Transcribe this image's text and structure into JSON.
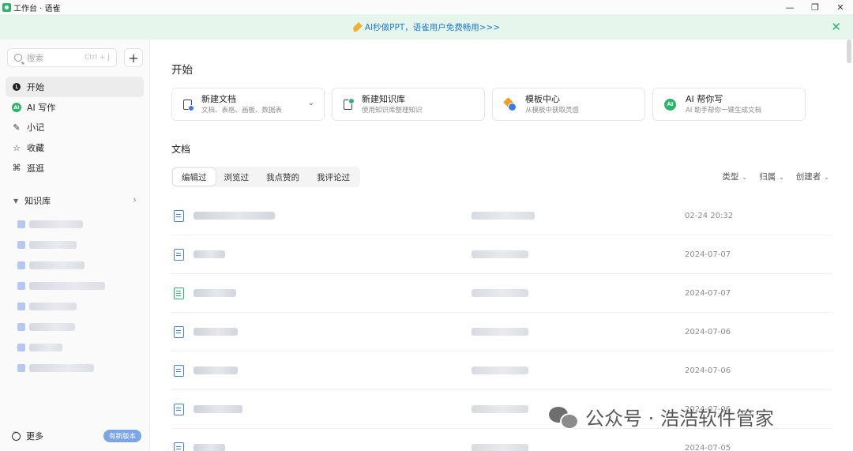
{
  "window": {
    "title": "工作台 · 语雀",
    "controls": [
      "—",
      "❐",
      "✕"
    ]
  },
  "banner": {
    "text": "AI秒做PPT，语雀用户免费畅用>>>",
    "close": "✕"
  },
  "sidebar": {
    "search_placeholder": "搜索",
    "search_shortcut": "Ctrl + J",
    "add_label": "+",
    "nav": [
      {
        "label": "开始",
        "icon": "start-icon"
      },
      {
        "label": "AI 写作",
        "icon": "ai-icon",
        "glyph": "AI"
      },
      {
        "label": "小记",
        "icon": "pen-icon",
        "glyph": "✎"
      },
      {
        "label": "收藏",
        "icon": "star-icon",
        "glyph": "☆"
      },
      {
        "label": "逛逛",
        "icon": "explore-icon",
        "glyph": "⌘"
      }
    ],
    "knowledge_base": {
      "label": "知识库",
      "caret": "▼",
      "chevron": "›"
    },
    "more_label": "更多",
    "new_version_label": "有新版本"
  },
  "main": {
    "start_title": "开始",
    "cards": [
      {
        "title": "新建文档",
        "subtitle": "文档、表格、画板、数据表",
        "icon": "doc-plus-icon",
        "arrow": "⌄"
      },
      {
        "title": "新建知识库",
        "subtitle": "使用知识库整理知识",
        "icon": "kb-plus-icon"
      },
      {
        "title": "模板中心",
        "subtitle": "从模板中获取灵感",
        "icon": "template-icon"
      },
      {
        "title": "AI 帮你写",
        "subtitle": "AI 助手帮你一键生成文档",
        "icon": "ai-icon",
        "glyph": "AI"
      }
    ],
    "docs_title": "文档",
    "tabs": [
      "编辑过",
      "浏览过",
      "我点赞的",
      "我评论过"
    ],
    "filters": [
      {
        "label": "类型",
        "arrow": "⌄"
      },
      {
        "label": "归属",
        "arrow": "⌄"
      },
      {
        "label": "创建者",
        "arrow": "⌄"
      }
    ],
    "documents": [
      {
        "type": "doc",
        "time": "02-24 20:32"
      },
      {
        "type": "doc",
        "time": "2024-07-07"
      },
      {
        "type": "sheet",
        "time": "2024-07-07"
      },
      {
        "type": "doc",
        "time": "2024-07-06"
      },
      {
        "type": "doc",
        "time": "2024-07-06"
      },
      {
        "type": "doc",
        "time": "2024-07-06"
      },
      {
        "type": "doc",
        "time": "2024-07-05"
      }
    ]
  },
  "watermark": {
    "text": "公众号 · 浩浩软件管家"
  }
}
